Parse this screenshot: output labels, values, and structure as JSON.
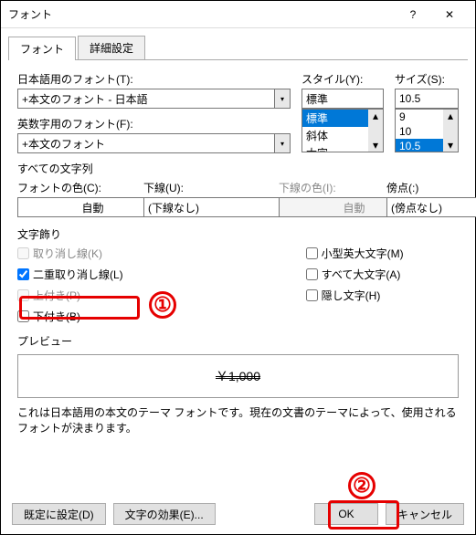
{
  "titlebar": {
    "title": "フォント",
    "help": "?",
    "close": "✕"
  },
  "tabs": {
    "font": "フォント",
    "advanced": "詳細設定"
  },
  "labels": {
    "jp_font": "日本語用のフォント(T):",
    "en_font": "英数字用のフォント(F):",
    "style": "スタイル(Y):",
    "size": "サイズ(S):",
    "all_chars": "すべての文字列",
    "font_color": "フォントの色(C):",
    "underline": "下線(U):",
    "underline_color": "下線の色(I):",
    "emphasis": "傍点(:)",
    "decoration": "文字飾り",
    "preview": "プレビュー"
  },
  "values": {
    "jp_font": "+本文のフォント - 日本語",
    "en_font": "+本文のフォント",
    "style": "標準",
    "size": "10.5",
    "font_color": "自動",
    "underline": "(下線なし)",
    "underline_color": "自動",
    "emphasis": "(傍点なし)"
  },
  "style_list": [
    "標準",
    "斜体",
    "太字"
  ],
  "size_list": [
    "9",
    "10",
    "10.5"
  ],
  "checks": {
    "strike": "取り消し線(K)",
    "dbl_strike": "二重取り消し線(L)",
    "superscript": "上付き(P)",
    "subscript": "下付き(B)",
    "smallcaps": "小型英大文字(M)",
    "allcaps": "すべて大文字(A)",
    "hidden": "隠し文字(H)"
  },
  "preview_text": "￥1,000",
  "note": "これは日本語用の本文のテーマ フォントです。現在の文書のテーマによって、使用されるフォントが決まります。",
  "footer": {
    "default": "既定に設定(D)",
    "effects": "文字の効果(E)...",
    "ok": "OK",
    "cancel": "キャンセル"
  },
  "callouts": {
    "one": "①",
    "two": "②"
  }
}
